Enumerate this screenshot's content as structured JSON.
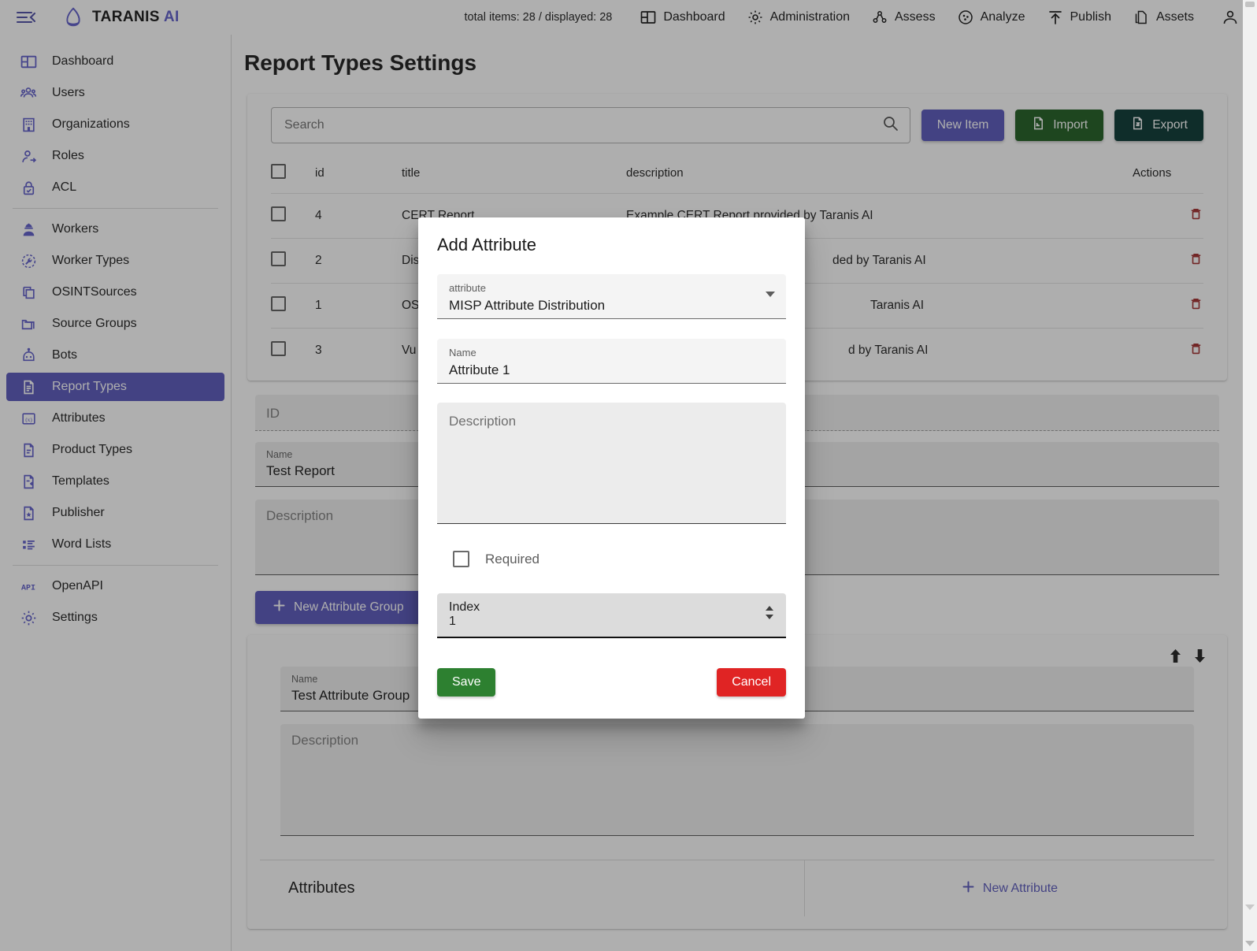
{
  "topbar": {
    "brand_name": "TARANIS",
    "brand_suffix": "AI",
    "total_items": "total items: 28 / displayed: 28",
    "nav": [
      {
        "label": "Dashboard",
        "icon": "dashboard-icon"
      },
      {
        "label": "Administration",
        "icon": "gear-icon"
      },
      {
        "label": "Assess",
        "icon": "assess-icon"
      },
      {
        "label": "Analyze",
        "icon": "analyze-icon"
      },
      {
        "label": "Publish",
        "icon": "upload-icon"
      },
      {
        "label": "Assets",
        "icon": "documents-icon"
      }
    ],
    "account_icon": "account-icon",
    "menu_toggle_icon": "menu-collapse-icon"
  },
  "sidebar": {
    "items": [
      {
        "label": "Dashboard",
        "icon": "dashboard-icon",
        "active": false
      },
      {
        "label": "Users",
        "icon": "users-icon",
        "active": false
      },
      {
        "label": "Organizations",
        "icon": "building-icon",
        "active": false
      },
      {
        "label": "Roles",
        "icon": "person-add-icon",
        "active": false
      },
      {
        "label": "ACL",
        "icon": "lock-check-icon",
        "active": false
      },
      {
        "label": "Workers",
        "icon": "worker-icon",
        "active": false
      },
      {
        "label": "Worker Types",
        "icon": "wrench-clock-icon",
        "active": false
      },
      {
        "label": "OSINTSources",
        "icon": "copy-icon",
        "active": false
      },
      {
        "label": "Source Groups",
        "icon": "folder-icon",
        "active": false
      },
      {
        "label": "Bots",
        "icon": "robot-icon",
        "active": false
      },
      {
        "label": "Report Types",
        "icon": "report-doc-icon",
        "active": true
      },
      {
        "label": "Attributes",
        "icon": "variable-icon",
        "active": false
      },
      {
        "label": "Product Types",
        "icon": "product-doc-icon",
        "active": false
      },
      {
        "label": "Templates",
        "icon": "doc-plus-icon",
        "active": false
      },
      {
        "label": "Publisher",
        "icon": "doc-star-icon",
        "active": false
      },
      {
        "label": "Word Lists",
        "icon": "list-icon",
        "active": false
      },
      {
        "label": "OpenAPI",
        "icon": "api-icon",
        "active": false
      },
      {
        "label": "Settings",
        "icon": "gear-icon",
        "active": false
      }
    ]
  },
  "main": {
    "page_title": "Report Types Settings",
    "search": {
      "value": "",
      "placeholder": "Search",
      "icon": "search-icon"
    },
    "buttons": {
      "new_item": "New Item",
      "import": "Import",
      "export": "Export"
    },
    "table": {
      "headers": [
        "id",
        "title",
        "description",
        "Actions"
      ],
      "rows": [
        {
          "id": "4",
          "title": "CERT Report",
          "description": "Example CERT Report provided by Taranis AI"
        },
        {
          "id": "2",
          "title": "Dis",
          "description": "ded by Taranis AI"
        },
        {
          "id": "1",
          "title": "OS",
          "description": "Taranis AI"
        },
        {
          "id": "3",
          "title": "Vu",
          "description": "d by Taranis AI"
        }
      ],
      "delete_icon": "trash-icon"
    },
    "form": {
      "id": {
        "label": "ID",
        "value": "",
        "placeholder": "ID"
      },
      "name": {
        "label": "Name",
        "value": "Test Report"
      },
      "description": {
        "label": "Description",
        "value": "",
        "placeholder": "Description"
      }
    },
    "new_attribute_group_button": "New Attribute Group",
    "attribute_group": {
      "move_up_icon": "arrow-up-icon",
      "move_down_icon": "arrow-down-icon",
      "name": {
        "label": "Name",
        "value": "Test Attribute Group"
      },
      "description": {
        "label": "Description",
        "value": "",
        "placeholder": "Description"
      },
      "attributes_title": "Attributes",
      "new_attribute_button": "New Attribute"
    }
  },
  "modal": {
    "title": "Add Attribute",
    "attribute_select": {
      "label": "attribute",
      "value": "MISP Attribute Distribution",
      "caret_icon": "chevron-down-icon"
    },
    "name": {
      "label": "Name",
      "value": "Attribute 1"
    },
    "description": {
      "label": "Description",
      "value": "",
      "placeholder": "Description"
    },
    "required": {
      "label": "Required",
      "checked": false
    },
    "index": {
      "label": "Index",
      "value": "1"
    },
    "save_button": "Save",
    "cancel_button": "Cancel"
  },
  "colors": {
    "brand_purple": "#5755ba",
    "import_green": "#1d5c1f",
    "export_dark_green": "#06352f",
    "save_green": "#2d8030",
    "cancel_red": "#e02424",
    "delete_red": "#a02a2a"
  }
}
